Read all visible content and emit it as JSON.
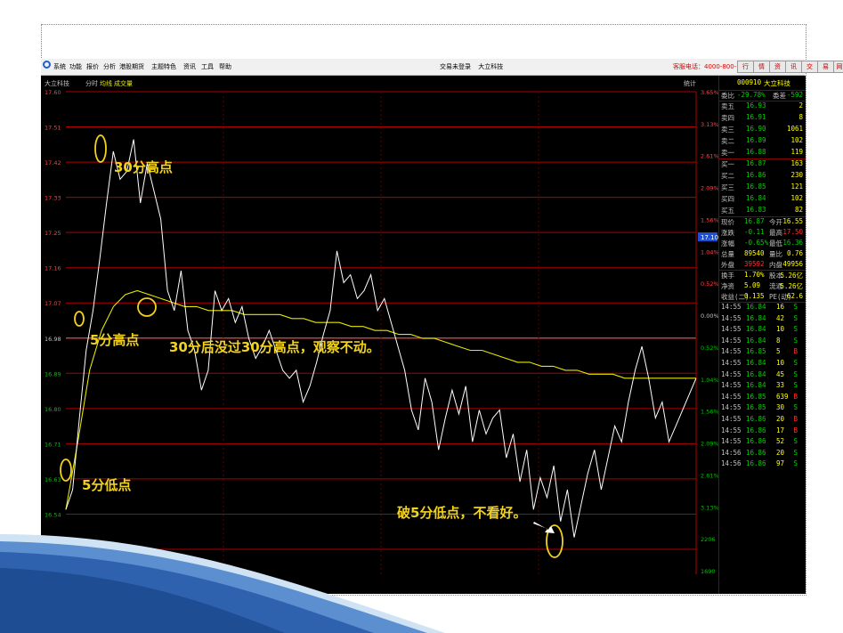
{
  "menu": {
    "items": [
      "系统",
      "功能",
      "报价",
      "分析",
      "港股期货",
      "主题特色",
      "资讯",
      "工具",
      "帮助"
    ],
    "app_title": "交易未登录",
    "app_name": "大立科技",
    "hotline": "客服电话：4000-800-162",
    "buttons": [
      "行",
      "情",
      "资",
      "讯",
      "交",
      "易",
      "网",
      "站"
    ]
  },
  "chart_header": {
    "name": "大立科技",
    "tabs": [
      "分时",
      "均线",
      "成交量"
    ],
    "right": "统计"
  },
  "chart_data": {
    "type": "line",
    "ylim": [
      16.45,
      17.6
    ],
    "price_ticks": [
      "17.60",
      "17.51",
      "17.42",
      "17.33",
      "17.25",
      "17.16",
      "17.07",
      "16.98",
      "16.89",
      "16.80",
      "16.71",
      "16.63",
      "16.54",
      "16.45"
    ],
    "pct_ticks": [
      "3.65%",
      "3.13%",
      "2.61%",
      "2.09%",
      "1.56%",
      "1.04%",
      "0.52%",
      "0.00%",
      "0.52%",
      "1.04%",
      "1.56%",
      "2.09%",
      "2.61%",
      "3.13%",
      "2206",
      "1690"
    ],
    "current_price_label": "17.10",
    "series": [
      {
        "values": [
          16.55,
          16.6,
          16.78,
          16.95,
          17.05,
          17.18,
          17.32,
          17.45,
          17.38,
          17.4,
          17.48,
          17.32,
          17.42,
          17.35,
          17.28,
          17.1,
          17.05,
          17.15,
          17.0,
          16.95,
          16.85,
          16.9,
          17.1,
          17.05,
          17.08,
          17.02,
          17.06,
          16.98,
          16.93,
          16.96,
          17.0,
          16.95,
          16.9,
          16.88,
          16.9,
          16.82,
          16.86,
          16.92,
          16.99,
          17.05,
          17.2,
          17.12,
          17.14,
          17.08,
          17.1,
          17.14,
          17.05,
          17.08,
          17.02,
          16.96,
          16.9,
          16.8,
          16.75,
          16.88,
          16.82,
          16.7,
          16.78,
          16.85,
          16.79,
          16.86,
          16.72,
          16.8,
          16.74,
          16.78,
          16.8,
          16.68,
          16.74,
          16.62,
          16.7,
          16.55,
          16.63,
          16.58,
          16.66,
          16.52,
          16.6,
          16.48,
          16.56,
          16.64,
          16.7,
          16.6,
          16.68,
          16.76,
          16.72,
          16.82,
          16.9,
          16.96,
          16.88,
          16.78,
          16.82,
          16.72,
          16.76,
          16.8,
          16.84,
          16.88
        ]
      },
      {
        "values": [
          16.55,
          16.72,
          16.9,
          17.0,
          17.06,
          17.09,
          17.1,
          17.09,
          17.08,
          17.07,
          17.06,
          17.06,
          17.05,
          17.05,
          17.05,
          17.04,
          17.04,
          17.04,
          17.04,
          17.03,
          17.03,
          17.02,
          17.02,
          17.02,
          17.01,
          17.01,
          17.0,
          17.0,
          16.99,
          16.99,
          16.98,
          16.98,
          16.97,
          16.96,
          16.95,
          16.95,
          16.94,
          16.93,
          16.92,
          16.92,
          16.91,
          16.91,
          16.9,
          16.9,
          16.89,
          16.89,
          16.89,
          16.88,
          16.88,
          16.88,
          16.88,
          16.88,
          16.88,
          16.88
        ]
      }
    ]
  },
  "annotations": [
    "30分高点",
    "5分高点",
    "30分后没过30分高点，观察不动。",
    "5分低点",
    "破5分低点，不看好。"
  ],
  "side": {
    "code": "000910",
    "name": "大立科技",
    "weibi_label": "委比",
    "weibi_value": "-29.78%",
    "weicha_label": "委差",
    "weicha_value": "-592",
    "asks": [
      {
        "label": "卖五",
        "price": "16.93",
        "vol": "2"
      },
      {
        "label": "卖四",
        "price": "16.91",
        "vol": "8"
      },
      {
        "label": "卖三",
        "price": "16.90",
        "vol": "1061"
      },
      {
        "label": "卖二",
        "price": "16.89",
        "vol": "102"
      },
      {
        "label": "卖一",
        "price": "16.88",
        "vol": "119"
      }
    ],
    "bids": [
      {
        "label": "买一",
        "price": "16.87",
        "vol": "163"
      },
      {
        "label": "买二",
        "price": "16.86",
        "vol": "230"
      },
      {
        "label": "买三",
        "price": "16.85",
        "vol": "121"
      },
      {
        "label": "买四",
        "price": "16.84",
        "vol": "102"
      },
      {
        "label": "买五",
        "price": "16.83",
        "vol": "82"
      }
    ],
    "stats": [
      {
        "l1": "现价",
        "v1": "16.87",
        "l2": "今开",
        "v2": "16.55"
      },
      {
        "l1": "涨跌",
        "v1": "-0.11",
        "l2": "最高",
        "v2": "17.50"
      },
      {
        "l1": "涨幅",
        "v1": "-0.65%",
        "l2": "最低",
        "v2": "16.36"
      },
      {
        "l1": "总量",
        "v1": "89540",
        "l2": "量比",
        "v2": "0.76"
      },
      {
        "l1": "外盘",
        "v1": "39592",
        "l2": "内盘",
        "v2": "49956"
      },
      {
        "l1": "换手",
        "v1": "1.70%",
        "l2": "股本",
        "v2": "5.26亿"
      },
      {
        "l1": "净资",
        "v1": "5.09",
        "l2": "流通",
        "v2": "5.26亿"
      },
      {
        "l1": "收益(二)",
        "v1": "0.135",
        "l2": "PE(动)",
        "v2": "62.6"
      }
    ],
    "ticks": [
      {
        "t": "14:55",
        "p": "16.84",
        "v": "16",
        "d": "S"
      },
      {
        "t": "14:55",
        "p": "16.84",
        "v": "42",
        "d": "S"
      },
      {
        "t": "14:55",
        "p": "16.84",
        "v": "10",
        "d": "S"
      },
      {
        "t": "14:55",
        "p": "16.84",
        "v": "8",
        "d": "S"
      },
      {
        "t": "14:55",
        "p": "16.85",
        "v": "5",
        "d": "B"
      },
      {
        "t": "14:55",
        "p": "16.84",
        "v": "10",
        "d": "S"
      },
      {
        "t": "14:55",
        "p": "16.84",
        "v": "45",
        "d": "S"
      },
      {
        "t": "14:55",
        "p": "16.84",
        "v": "33",
        "d": "S"
      },
      {
        "t": "14:55",
        "p": "16.85",
        "v": "639",
        "d": "B"
      },
      {
        "t": "14:55",
        "p": "16.85",
        "v": "30",
        "d": "S"
      },
      {
        "t": "14:55",
        "p": "16.86",
        "v": "20",
        "d": "B"
      },
      {
        "t": "14:55",
        "p": "16.86",
        "v": "17",
        "d": "B"
      },
      {
        "t": "14:55",
        "p": "16.86",
        "v": "52",
        "d": "S"
      },
      {
        "t": "14:56",
        "p": "16.86",
        "v": "20",
        "d": "S"
      },
      {
        "t": "14:56",
        "p": "16.86",
        "v": "97",
        "d": "S"
      }
    ]
  },
  "colors": {
    "up": "#ff3030",
    "down": "#00d000",
    "price": "#ffffff",
    "avg": "#e6e600",
    "grid": "#c00000",
    "annotation": "#f2d21b",
    "background": "#000000"
  }
}
